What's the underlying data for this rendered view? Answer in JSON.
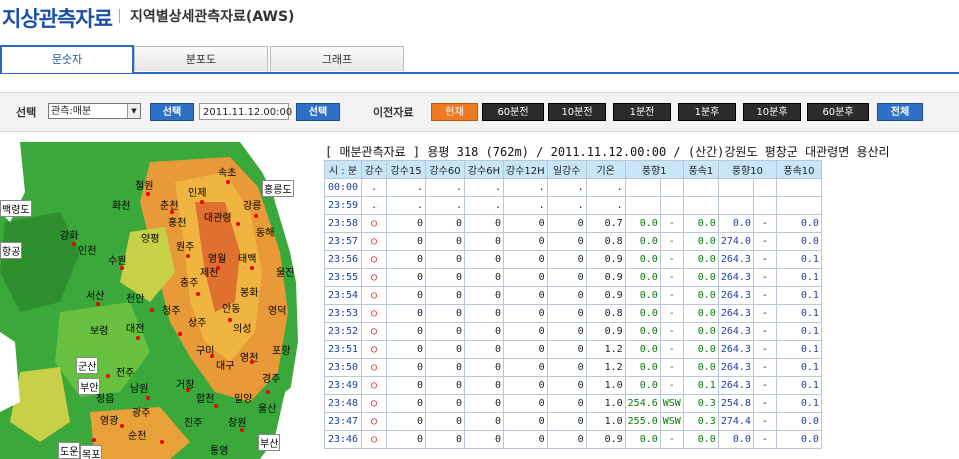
{
  "header": {
    "title": "지상관측자료",
    "subtitle": "지역별상세관측자료(AWS)"
  },
  "tabs": [
    {
      "label": "문숫자"
    },
    {
      "label": "분포도"
    },
    {
      "label": "그래프"
    }
  ],
  "controls": {
    "select_label": "선택",
    "select_value": "관측:매분",
    "select_button": "선택",
    "datetime": "2011.11.12.00:00",
    "datetime_button": "선택",
    "prev_label": "이전자료",
    "nav": [
      "현재",
      "60분전",
      "10분전",
      "1분전",
      "1분후",
      "10분후",
      "60분후"
    ],
    "all_button": "전체"
  },
  "map": {
    "cities": [
      "속초",
      "철원",
      "춘천",
      "인제",
      "홍천",
      "대관령",
      "강릉",
      "동해",
      "화천",
      "강화",
      "인천",
      "수원",
      "양평",
      "원주",
      "영월",
      "태백",
      "울진",
      "서산",
      "천안",
      "충주",
      "봉화",
      "제천",
      "안동",
      "영덕",
      "보령",
      "대전",
      "청주",
      "상주",
      "의성",
      "포항",
      "군산",
      "전주",
      "구미",
      "대구",
      "영천",
      "경주",
      "부안",
      "정읍",
      "남원",
      "거창",
      "합천",
      "밀양",
      "울산",
      "목포",
      "영광",
      "광주",
      "순천",
      "진주",
      "창원",
      "부산",
      "통영",
      "백령도",
      "항공",
      "홍릉도",
      "도운"
    ]
  },
  "table": {
    "title": "[ 매분관측자료 ] 용평 318 (762m) / 2011.11.12.00:00 / (산간)강원도 평창군 대관령면 용산리",
    "headers": [
      "시 : 분",
      "강수",
      "강수15",
      "강수60",
      "강수6H",
      "강수12H",
      "일강수",
      "기온",
      "풍향1",
      "풍속1",
      "풍향10",
      "풍속10"
    ],
    "rows": [
      [
        "00:00",
        ".",
        ".",
        ".",
        ".",
        ".",
        ".",
        ".",
        "",
        "",
        "",
        "",
        "",
        ""
      ],
      [
        "23:59",
        ".",
        ".",
        ".",
        ".",
        ".",
        ".",
        ".",
        "",
        "",
        "",
        "",
        "",
        ""
      ],
      [
        "23:58",
        "○",
        "0",
        "0",
        "0",
        "0",
        "0",
        "0.7",
        "0.0",
        "-",
        "0.0",
        "0.0",
        "-",
        "0.0"
      ],
      [
        "23:57",
        "○",
        "0",
        "0",
        "0",
        "0",
        "0",
        "0.8",
        "0.0",
        "-",
        "0.0",
        "274.0",
        "-",
        "0.0"
      ],
      [
        "23:56",
        "○",
        "0",
        "0",
        "0",
        "0",
        "0",
        "0.9",
        "0.0",
        "-",
        "0.0",
        "264.3",
        "-",
        "0.1"
      ],
      [
        "23:55",
        "○",
        "0",
        "0",
        "0",
        "0",
        "0",
        "0.9",
        "0.0",
        "-",
        "0.0",
        "264.3",
        "-",
        "0.1"
      ],
      [
        "23:54",
        "○",
        "0",
        "0",
        "0",
        "0",
        "0",
        "0.9",
        "0.0",
        "-",
        "0.0",
        "264.3",
        "-",
        "0.1"
      ],
      [
        "23:53",
        "○",
        "0",
        "0",
        "0",
        "0",
        "0",
        "0.8",
        "0.0",
        "-",
        "0.0",
        "264.3",
        "-",
        "0.1"
      ],
      [
        "23:52",
        "○",
        "0",
        "0",
        "0",
        "0",
        "0",
        "0.9",
        "0.0",
        "-",
        "0.0",
        "264.3",
        "-",
        "0.1"
      ],
      [
        "23:51",
        "○",
        "0",
        "0",
        "0",
        "0",
        "0",
        "1.2",
        "0.0",
        "-",
        "0.0",
        "264.3",
        "-",
        "0.1"
      ],
      [
        "23:50",
        "○",
        "0",
        "0",
        "0",
        "0",
        "0",
        "1.2",
        "0.0",
        "-",
        "0.0",
        "264.3",
        "-",
        "0.1"
      ],
      [
        "23:49",
        "○",
        "0",
        "0",
        "0",
        "0",
        "0",
        "1.0",
        "0.0",
        "-",
        "0.1",
        "264.3",
        "-",
        "0.1"
      ],
      [
        "23:48",
        "○",
        "0",
        "0",
        "0",
        "0",
        "0",
        "1.0",
        "254.6",
        "WSW",
        "0.3",
        "254.8",
        "-",
        "0.1"
      ],
      [
        "23:47",
        "○",
        "0",
        "0",
        "0",
        "0",
        "0",
        "1.0",
        "255.0",
        "WSW",
        "0.3",
        "274.4",
        "-",
        "0.0"
      ],
      [
        "23:46",
        "○",
        "0",
        "0",
        "0",
        "0",
        "0",
        "0.9",
        "0.0",
        "-",
        "0.0",
        "0.0",
        "-",
        "0.0"
      ]
    ]
  }
}
